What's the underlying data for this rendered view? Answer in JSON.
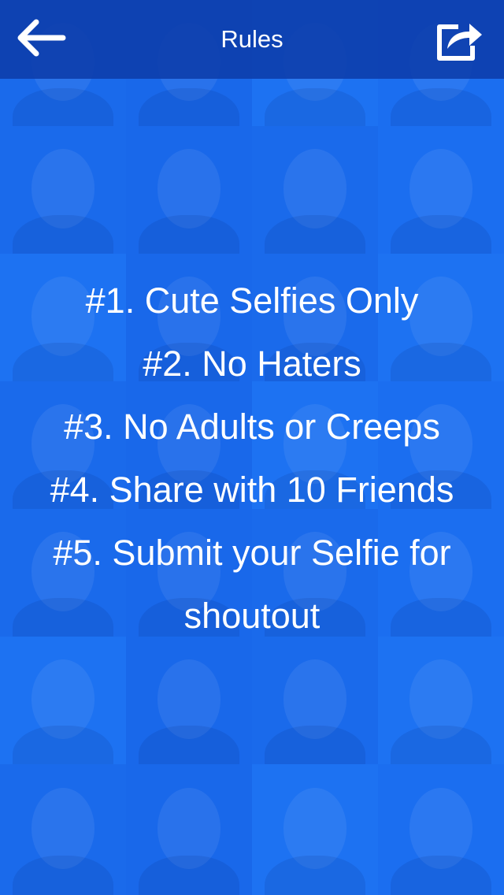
{
  "header": {
    "title": "Rules",
    "back_icon": "arrow-left-icon",
    "share_icon": "share-icon",
    "background": "#0c3caa"
  },
  "rules": [
    "#1. Cute Selfies Only",
    "#2. No Haters",
    "#3. No Adults or Creeps",
    "#4. Share with 10 Friends",
    "#5. Submit your Selfie for shoutout"
  ],
  "colors": {
    "accent": "#1766e8",
    "text": "#ffffff"
  }
}
